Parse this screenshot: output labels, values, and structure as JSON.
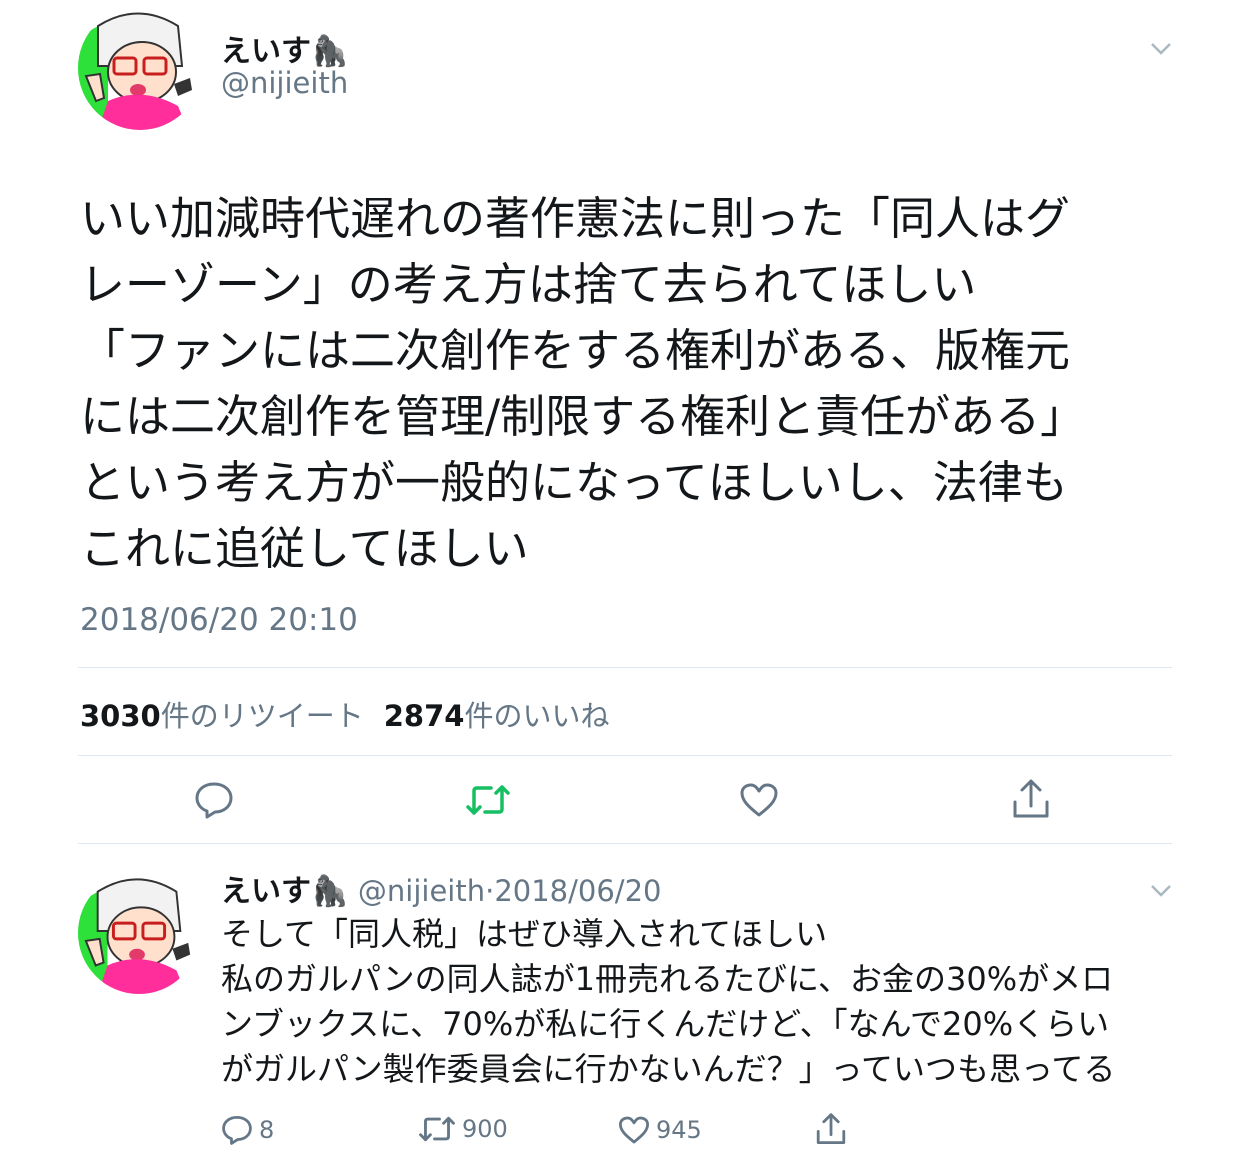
{
  "tweet": {
    "author_name": "えいす🦍",
    "author_handle": "@nijieith",
    "avatar_icon": "cartoon-avatar",
    "lines": [
      "いい加減時代遅れの著作憲法に則った「同人はグ",
      "レーゾーン」の考え方は捨て去られてほしい",
      "「ファンには二次創作をする権利がある、版権元",
      "には二次創作を管理/制限する権利と責任がある」",
      "という考え方が一般的になってほしいし、法律も",
      "これに追従してほしい"
    ],
    "timestamp": "2018/06/20 20:10",
    "retweet_count": "3030",
    "retweet_label": "件のリツイート",
    "like_count": "2874",
    "like_label": "件のいいね",
    "actions": [
      "reply-icon",
      "retweet-icon",
      "like-icon",
      "share-icon"
    ]
  },
  "reply": {
    "author_name": "えいす🦍",
    "author_handle": "@nijieith",
    "separator": "·",
    "date": "2018/06/20",
    "lines": [
      "そして「同人税」はぜひ導入されてほしい",
      "私のガルパンの同人誌が1冊売れるたびに、お金の30%がメロ",
      "ンブックスに、70%が私に行くんだけど、「なんで20%くらい",
      "がガルパン製作委員会に行かないんだ？」っていつも思ってる"
    ],
    "reply_count": "8",
    "retweet_count": "900",
    "like_count": "945"
  },
  "colors": {
    "text": "#14171a",
    "secondary": "#657786",
    "retweet_green": "#17bf63",
    "divider": "#e1e8ed"
  }
}
